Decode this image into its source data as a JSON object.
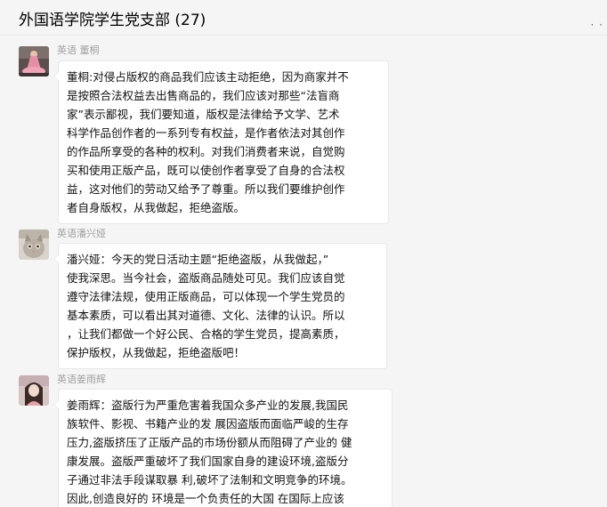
{
  "chat": {
    "title": "外国语学院学生党支部 (27)",
    "more_icon": "more-dots-icon"
  },
  "messages": [
    {
      "sender": "英语 董桐",
      "avatar_icon": "avatar-photo-pink-dress",
      "lines": [
        "董桐:对侵占版权的商品我们应该主动拒绝，因为商家并不",
        "是按照合法权益去出售商品的，我们应该对那些“法盲商",
        "家”表示鄙视，我们要知道，版权是法律给予文学、艺术",
        "科学作品创作者的一系列专有权益，是作者依法对其创作",
        "的作品所享受的各种的权利。对我们消费者来说，自觉购",
        "买和使用正版产品，既可以使创作者享受了自身的合法权",
        "益，这对他们的劳动又给予了尊重。所以我们要维护创作",
        "者自身版权，从我做起，拒绝盗版。"
      ]
    },
    {
      "sender": "英语潘兴娅",
      "avatar_icon": "avatar-photo-cat",
      "lines": [
        "潘兴娅：今天的党日活动主题“拒绝盗版，从我做起，”",
        "使我深思。当今社会，盗版商品随处可见。我们应该自觉",
        "遵守法律法规，使用正版商品，可以体现一个学生党员的",
        "基本素质，可以看出其对道德、文化、法律的认识。所以",
        "，让我们都做一个好公民、合格的学生党员，提高素质，",
        "保护版权，从我做起，拒绝盗版吧！"
      ]
    },
    {
      "sender": "英语姜雨辉",
      "avatar_icon": "avatar-photo-girl",
      "lines": [
        "姜雨辉：盗版行为严重危害着我国众多产业的发展,我国民",
        "族软件、影视、书籍产业的发 展因盗版而面临严峻的生存",
        "压力,盗版挤压了正版产品的市场份额从而阻碍了产业的 健",
        "康发展。盗版严重破坏了我们国家自身的建设环境,盗版分",
        "子通过非法手段谋取暴 利,破坏了法制和文明竞争的环境。",
        "因此,创造良好的 环境是一个负责任的大国 在国际上应该"
      ]
    }
  ]
}
